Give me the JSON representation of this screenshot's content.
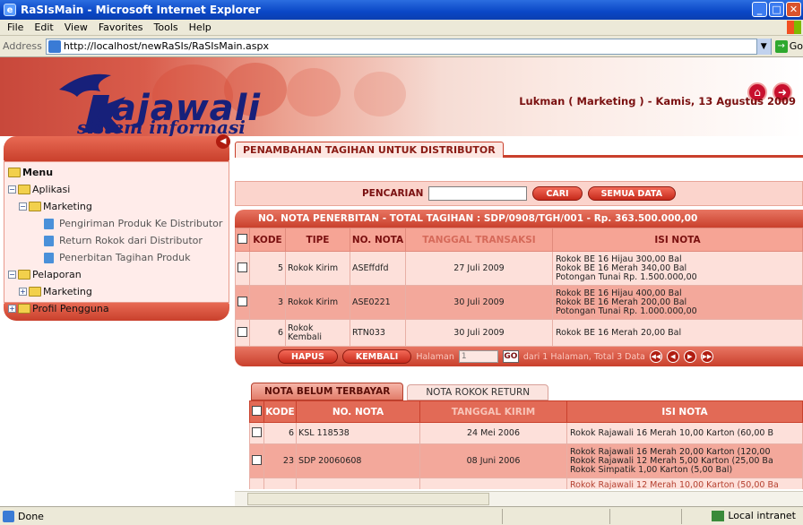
{
  "window": {
    "title": "RaSIsMain - Microsoft Internet Explorer"
  },
  "menubar": {
    "items": [
      "File",
      "Edit",
      "View",
      "Favorites",
      "Tools",
      "Help"
    ]
  },
  "address": {
    "label": "Address",
    "url": "http://localhost/newRaSIs/RaSIsMain.aspx",
    "go_label": "Go"
  },
  "header": {
    "brand": "ajawali",
    "brand_sub": "sistem informasi",
    "user_info": "Lukman ( Marketing ) - Kamis, 13 Agustus 2009"
  },
  "sidebar": {
    "items": [
      {
        "label": "Menu"
      },
      {
        "label": "Aplikasi"
      },
      {
        "label": "Marketing"
      },
      {
        "label": "Pengiriman Produk Ke Distributor"
      },
      {
        "label": "Return Rokok dari Distributor"
      },
      {
        "label": "Penerbitan Tagihan Produk"
      },
      {
        "label": "Pelaporan"
      },
      {
        "label": "Marketing"
      },
      {
        "label": "Profil Pengguna"
      }
    ]
  },
  "main": {
    "title": "PENAMBAHAN TAGIHAN UNTUK DISTRIBUTOR",
    "search": {
      "label": "PENCARIAN",
      "cari_button": "CARI",
      "semua_button": "SEMUA DATA"
    },
    "nota_header": "NO. NOTA PENERBITAN - TOTAL TAGIHAN : SDP/0908/TGH/001 - Rp. 363.500.000,00",
    "table1": {
      "headers": [
        "KODE",
        "TIPE",
        "NO. NOTA",
        "TANGGAL TRANSAKSI",
        "ISI NOTA"
      ],
      "rows": [
        {
          "kode": "5",
          "tipe": "Rokok Kirim",
          "nota": "ASEffdfd",
          "tanggal": "27 Juli 2009",
          "isi1": "Rokok BE 16 Hijau 300,00 Bal",
          "isi2": "Rokok BE 16 Merah 340,00 Bal",
          "isi3": "Potongan Tunai Rp. 1.500.000,00"
        },
        {
          "kode": "3",
          "tipe": "Rokok Kirim",
          "nota": "ASE0221",
          "tanggal": "30 Juli 2009",
          "isi1": "Rokok BE 16 Hijau 400,00 Bal",
          "isi2": "Rokok BE 16 Merah 200,00 Bal",
          "isi3": "Potongan Tunai Rp. 1.000.000,00"
        },
        {
          "kode": "6",
          "tipe": "Rokok Kembali",
          "nota": "RTN033",
          "tanggal": "30 Juli 2009",
          "isi1": "Rokok BE 16 Merah 20,00 Bal",
          "isi2": "",
          "isi3": ""
        }
      ]
    },
    "pager": {
      "hapus": "HAPUS",
      "kembali": "KEMBALI",
      "halaman_label": "Halaman",
      "halaman_value": "1",
      "go": "GO",
      "info": "dari 1 Halaman, Total 3 Data"
    },
    "tabs": {
      "tab1": "NOTA BELUM TERBAYAR",
      "tab2": "NOTA ROKOK RETURN"
    },
    "table2": {
      "headers": [
        "KODE",
        "NO. NOTA",
        "TANGGAL KIRIM",
        "ISI NOTA"
      ],
      "rows": [
        {
          "kode": "6",
          "nota": "KSL 118538",
          "tanggal": "24 Mei 2006",
          "isi1": "Rokok Rajawali 16 Merah 10,00 Karton (60,00 B",
          "isi2": "",
          "isi3": ""
        },
        {
          "kode": "23",
          "nota": "SDP 20060608",
          "tanggal": "08 Juni 2006",
          "isi1": "Rokok Rajawali 16 Merah 20,00 Karton (120,00",
          "isi2": "Rokok Rajawali 12 Merah 5,00 Karton (25,00 Ba",
          "isi3": "Rokok Simpatik 1,00 Karton (5,00 Bal)"
        },
        {
          "kode": "",
          "nota": "",
          "tanggal": "",
          "isi1": "Rokok Rajawali 12 Merah 10,00 Karton (50,00 Ba",
          "isi2": "",
          "isi3": ""
        }
      ]
    }
  },
  "status": {
    "left": "Done",
    "zone": "Local intranet"
  },
  "colors": {
    "accent": "#c9402c",
    "row_light": "#fde0da",
    "row_dark": "#f3a89b",
    "brand": "#17207a"
  }
}
